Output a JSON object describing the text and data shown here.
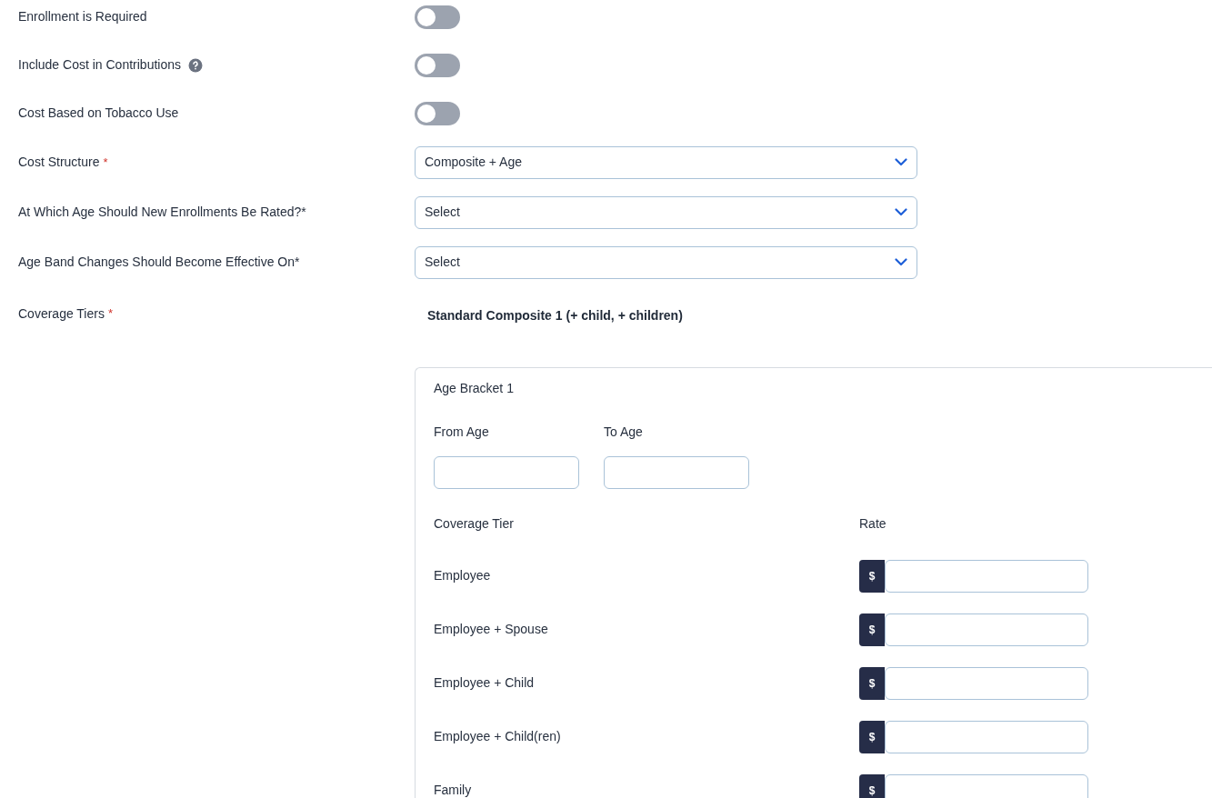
{
  "fields": [
    {
      "kind": "toggle",
      "label": "Enrollment is Required",
      "on": false
    },
    {
      "kind": "toggle",
      "label": "Include Cost in Contributions",
      "help": true,
      "on": false
    },
    {
      "kind": "toggle",
      "label": "Cost Based on Tobacco Use",
      "on": false
    },
    {
      "kind": "select",
      "label": "Cost Structure",
      "required_mark": "*",
      "value": "Composite + Age"
    },
    {
      "kind": "select",
      "label": "At Which Age Should New Enrollments Be Rated?*",
      "value": "Select"
    },
    {
      "kind": "select",
      "label": "Age Band Changes Should Become Effective On*",
      "value": "Select"
    },
    {
      "kind": "heading",
      "label": "Coverage Tiers",
      "required_mark": "*",
      "value": "Standard Composite 1 (+ child, + children)"
    }
  ],
  "bracket": {
    "title": "Age Bracket 1",
    "from_label": "From Age",
    "to_label": "To Age",
    "tier_header": "Coverage Tier",
    "rate_header": "Rate",
    "currency": "$",
    "tiers": [
      "Employee",
      "Employee + Spouse",
      "Employee + Child",
      "Employee + Child(ren)",
      "Family"
    ]
  }
}
